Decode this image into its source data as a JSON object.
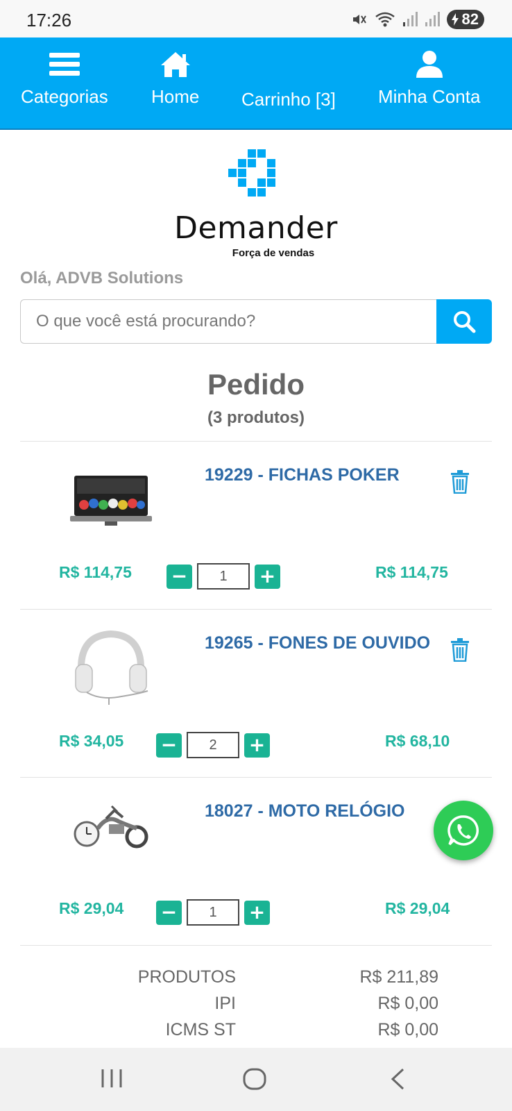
{
  "status_bar": {
    "time": "17:26",
    "battery": "82"
  },
  "nav": {
    "categories": "Categorias",
    "home": "Home",
    "cart": "Carrinho [3]",
    "account": "Minha Conta"
  },
  "brand": {
    "name": "Demander",
    "tagline": "Força de vendas"
  },
  "greeting": "Olá, ADVB Solutions",
  "search": {
    "placeholder": "O que você está procurando?"
  },
  "order": {
    "title": "Pedido",
    "count": "(3 produtos)"
  },
  "items": [
    {
      "name": "19229 - FICHAS POKER",
      "unit_price": "R$ 114,75",
      "quantity": "1",
      "total": "R$ 114,75",
      "image": "poker-chips-case"
    },
    {
      "name": "19265 - FONES DE OUVIDO",
      "unit_price": "R$ 34,05",
      "quantity": "2",
      "total": "R$ 68,10",
      "image": "headphones"
    },
    {
      "name": "18027 - MOTO RELÓGIO",
      "unit_price": "R$ 29,04",
      "quantity": "1",
      "total": "R$ 29,04",
      "image": "motorcycle-clock"
    }
  ],
  "totals": [
    {
      "label": "PRODUTOS",
      "value": "R$ 211,89"
    },
    {
      "label": "IPI",
      "value": "R$ 0,00"
    },
    {
      "label": "ICMS ST",
      "value": "R$ 0,00"
    }
  ],
  "colors": {
    "primary": "#00a9f4",
    "price": "#22b5a0",
    "product_name": "#2e6aa6",
    "qty_button": "#1ab394",
    "whatsapp": "#2ecc56"
  },
  "icons": {
    "nav": [
      "menu-icon",
      "home-icon",
      "user-icon"
    ],
    "item": [
      "trash-icon",
      "minus-icon",
      "plus-icon"
    ],
    "floating": "whatsapp-icon",
    "system": [
      "recent-apps-icon",
      "home-circle-icon",
      "back-icon"
    ]
  }
}
